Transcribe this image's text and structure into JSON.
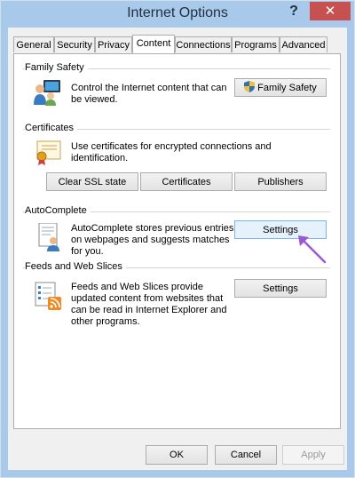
{
  "window": {
    "title": "Internet Options",
    "help_glyph": "?",
    "close_glyph": "✕"
  },
  "tabs": [
    {
      "label": "General"
    },
    {
      "label": "Security"
    },
    {
      "label": "Privacy"
    },
    {
      "label": "Content",
      "active": true
    },
    {
      "label": "Connections"
    },
    {
      "label": "Programs"
    },
    {
      "label": "Advanced"
    }
  ],
  "family_safety": {
    "label": "Family Safety",
    "description": "Control the Internet content that can be viewed.",
    "button_label": "Family Safety"
  },
  "certificates": {
    "label": "Certificates",
    "description": "Use certificates for encrypted connections and identification.",
    "clear_ssl_label": "Clear SSL state",
    "certificates_label": "Certificates",
    "publishers_label": "Publishers"
  },
  "autocomplete": {
    "label": "AutoComplete",
    "description": "AutoComplete stores previous entries on webpages and suggests matches for you.",
    "settings_label": "Settings"
  },
  "feeds": {
    "label": "Feeds and Web Slices",
    "description": "Feeds and Web Slices provide updated content from websites that can be read in Internet Explorer and other programs.",
    "settings_label": "Settings"
  },
  "footer": {
    "ok_label": "OK",
    "cancel_label": "Cancel",
    "apply_label": "Apply"
  },
  "colors": {
    "titlebar": "#a9c9ea",
    "close": "#c75050",
    "arrow": "#9b59d0"
  }
}
